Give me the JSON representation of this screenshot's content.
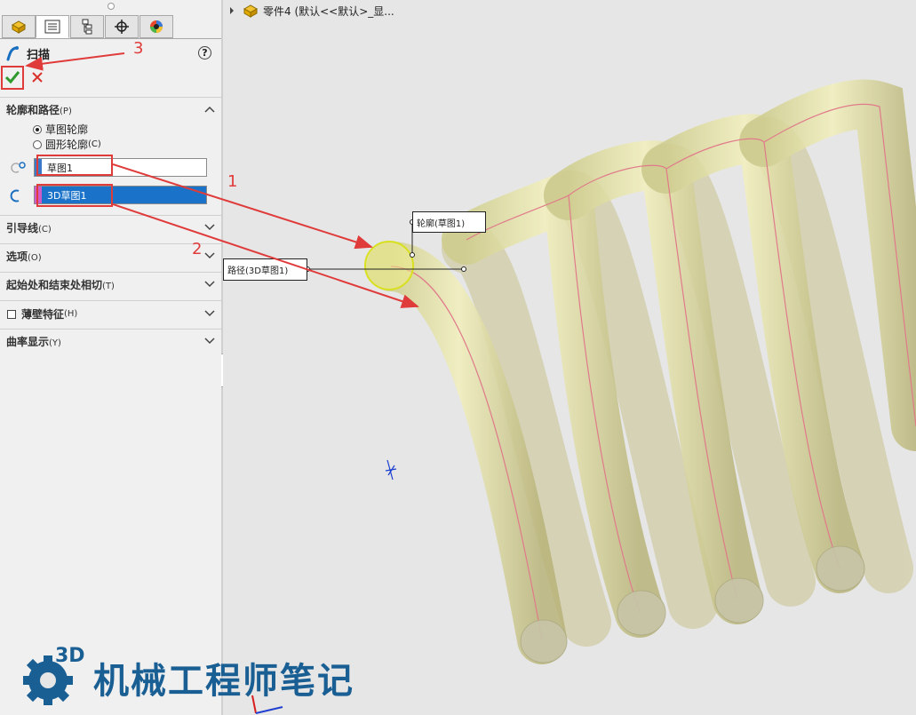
{
  "tree": {
    "part_label": "零件4  (默认<<默认>_显..."
  },
  "panel": {
    "tabs": [
      "feature-manager",
      "property-manager",
      "configuration-manager",
      "dimxpert-manager",
      "display-manager"
    ],
    "title": "扫描",
    "help": "?",
    "sections": {
      "profile_path": {
        "title": "轮廓和路径",
        "key": "(P)"
      },
      "guide_curves": {
        "title": "引导线",
        "key": "(C)"
      },
      "options": {
        "title": "选项",
        "key": "(O)"
      },
      "tangency": {
        "title": "起始处和结束处相切",
        "key": "(T)"
      },
      "thin_feature": {
        "title": "薄壁特征",
        "key": "(H)"
      },
      "curvature": {
        "title": "曲率显示",
        "key": "(Y)"
      }
    },
    "radios": [
      {
        "label": "草图轮廓",
        "selected": true
      },
      {
        "label": "圆形轮廓",
        "key": "(C)",
        "selected": false
      }
    ],
    "profile_field": "草图1",
    "path_field": "3D草图1"
  },
  "callouts": {
    "profile": "轮廓(草图1)",
    "path": "路径(3D草图1)"
  },
  "annotations": {
    "n1": "1",
    "n2": "2",
    "n3": "3"
  },
  "watermark": {
    "badge": "3D",
    "text": "机械工程师笔记"
  },
  "colors": {
    "accent": "#1a73c9",
    "annotation_red": "#e03b3b",
    "spring": "#e8e6a8",
    "logo": "#1a5f94"
  }
}
